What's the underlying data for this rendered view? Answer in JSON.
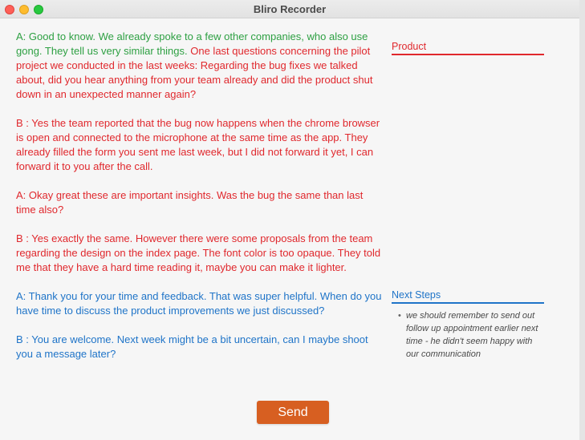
{
  "window": {
    "title": "Bliro Recorder"
  },
  "transcript": [
    {
      "segments": [
        {
          "text": "A: Good to know. We already spoke to a few other companies, who also use gong. They tell us very similar things. ",
          "color": "green"
        },
        {
          "text": "One last questions concerning the pilot project we conducted in the last weeks: Regarding the bug fixes we talked about, did you hear anything from your team already and did the product shut down in an unexpected manner again?",
          "color": "red"
        }
      ]
    },
    {
      "segments": [
        {
          "text": "B : Yes the team reported that the bug now happens when the chrome browser is open and connected to the microphone at the same time as the app. They already filled the form you sent me last week, but I did not forward it yet, I can forward it to you after the call.",
          "color": "red"
        }
      ]
    },
    {
      "segments": [
        {
          "text": "A: Okay great these are important insights. Was the bug the same than last time also?",
          "color": "red"
        }
      ]
    },
    {
      "segments": [
        {
          "text": "B : Yes exactly the same. However there were some proposals from the team regarding the design on the index page. The font color is too opaque. They told me that they have a hard time reading it, maybe you can make it lighter.",
          "color": "red"
        }
      ]
    },
    {
      "segments": [
        {
          "text": "A: Thank you for your time and feedback. That was super helpful. When do you have time to discuss the product improvements we just discussed?",
          "color": "blue"
        }
      ]
    },
    {
      "segments": [
        {
          "text": "B : You are welcome. Next week might be a bit uncertain, can I maybe shoot you a message later?",
          "color": "blue"
        }
      ]
    }
  ],
  "panels": {
    "product": {
      "title": "Product",
      "color": "#e0282d"
    },
    "next_steps": {
      "title": "Next Steps",
      "color": "#1f74c8",
      "bullets": [
        "we should remember to send out follow up appointment earlier next time - he didn't seem happy with our communication"
      ]
    }
  },
  "actions": {
    "send_label": "Send"
  },
  "colors": {
    "green": "#2ea043",
    "red": "#e0282d",
    "blue": "#1f74c8",
    "send_button": "#d75f21"
  }
}
